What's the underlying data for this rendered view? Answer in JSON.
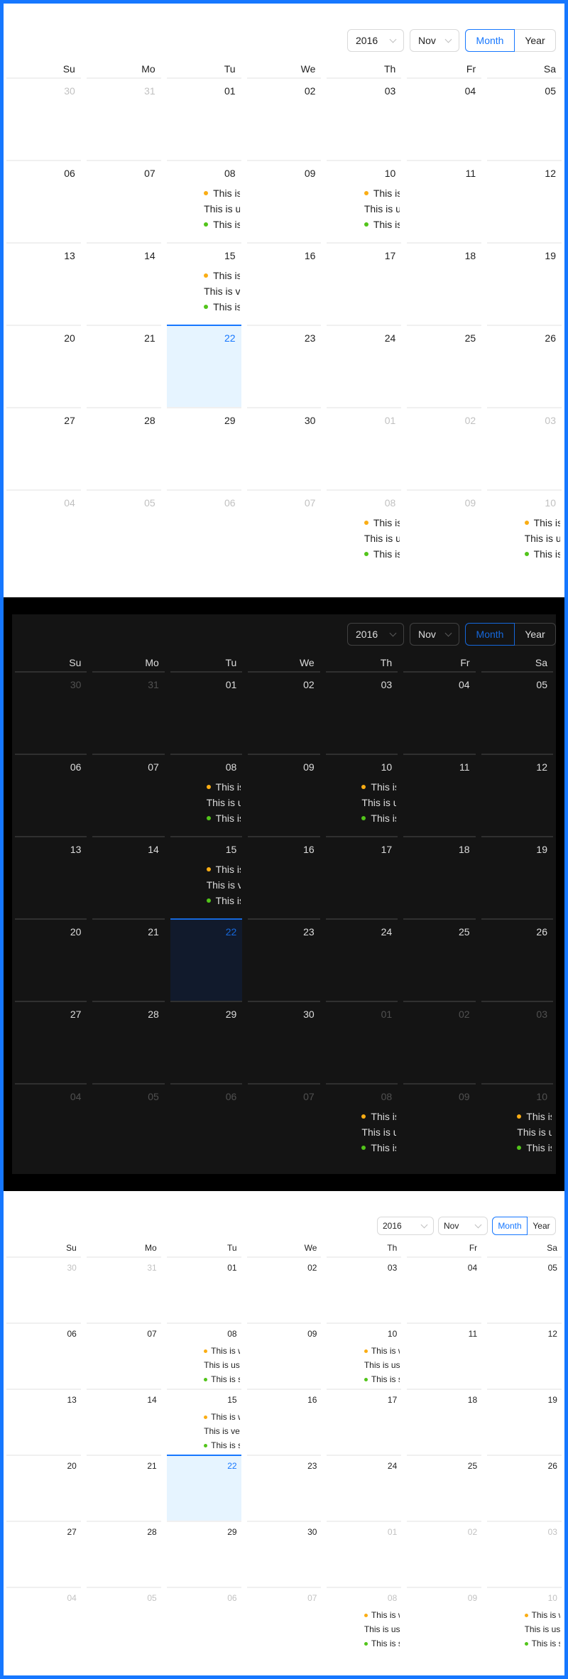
{
  "calendars": [
    {
      "theme": "light",
      "year": "2016",
      "month": "Nov",
      "mode_month": "Month",
      "mode_year": "Year"
    },
    {
      "theme": "dark",
      "year": "2016",
      "month": "Nov",
      "mode_month": "Month",
      "mode_year": "Year"
    },
    {
      "theme": "light-small",
      "year": "2016",
      "month": "Nov",
      "mode_month": "Month",
      "mode_year": "Year"
    }
  ],
  "weekdays": [
    "Su",
    "Mo",
    "Tu",
    "We",
    "Th",
    "Fr",
    "Sa"
  ],
  "weeks": [
    [
      {
        "d": "30",
        "out": true
      },
      {
        "d": "31",
        "out": true
      },
      {
        "d": "01"
      },
      {
        "d": "02"
      },
      {
        "d": "03"
      },
      {
        "d": "04"
      },
      {
        "d": "05"
      }
    ],
    [
      {
        "d": "06"
      },
      {
        "d": "07"
      },
      {
        "d": "08",
        "ev": "a"
      },
      {
        "d": "09"
      },
      {
        "d": "10",
        "ev": "a"
      },
      {
        "d": "11"
      },
      {
        "d": "12"
      }
    ],
    [
      {
        "d": "13"
      },
      {
        "d": "14"
      },
      {
        "d": "15",
        "ev": "b"
      },
      {
        "d": "16"
      },
      {
        "d": "17"
      },
      {
        "d": "18"
      },
      {
        "d": "19"
      }
    ],
    [
      {
        "d": "20"
      },
      {
        "d": "21"
      },
      {
        "d": "22",
        "today": true
      },
      {
        "d": "23"
      },
      {
        "d": "24"
      },
      {
        "d": "25"
      },
      {
        "d": "26"
      }
    ],
    [
      {
        "d": "27"
      },
      {
        "d": "28"
      },
      {
        "d": "29"
      },
      {
        "d": "30"
      },
      {
        "d": "01",
        "out": true
      },
      {
        "d": "02",
        "out": true
      },
      {
        "d": "03",
        "out": true
      }
    ],
    [
      {
        "d": "04",
        "out": true
      },
      {
        "d": "05",
        "out": true
      },
      {
        "d": "06",
        "out": true
      },
      {
        "d": "07",
        "out": true
      },
      {
        "d": "08",
        "out": true,
        "ev": "a"
      },
      {
        "d": "09",
        "out": true
      },
      {
        "d": "10",
        "out": true,
        "ev": "a"
      }
    ]
  ],
  "event_sets": {
    "a": [
      {
        "type": "warning",
        "text": "This is warning event."
      },
      {
        "type": "plain",
        "text": "This is usual event."
      },
      {
        "type": "success",
        "text": "This is success event."
      }
    ],
    "b": [
      {
        "type": "warning",
        "text": "This is warning event"
      },
      {
        "type": "plain",
        "text": "This is very long usual event"
      },
      {
        "type": "success",
        "text": "This is success event."
      }
    ]
  },
  "colors": {
    "primary": "#1677ff",
    "warning": "#faad14",
    "success": "#52c41a",
    "today_bg": "#e6f4ff",
    "dark_bg": "#141414"
  }
}
